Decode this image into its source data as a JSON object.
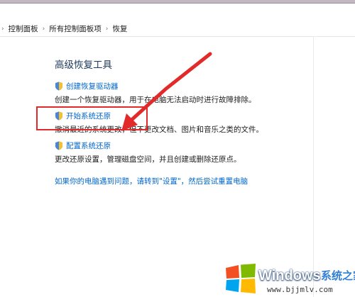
{
  "breadcrumb": {
    "items": [
      "控制面板",
      "所有控制面板项",
      "恢复"
    ],
    "separator": "›"
  },
  "page": {
    "title": "高级恢复工具"
  },
  "tools": [
    {
      "link": "创建恢复驱动器",
      "description": "创建一个恢复驱动器，用于在电脑无法启动时进行故障排除。"
    },
    {
      "link": "开始系统还原",
      "description": "撤消最近的系统更改，但不更改文档、图片和音乐之类的文件。"
    },
    {
      "link": "配置系统还原",
      "description": "更改还原设置，管理磁盘空间，并且创建或删除还原点。"
    }
  ],
  "footer": {
    "link": "如果你的电脑遇到问题，请转到\"设置\"，然后尝试重置电脑"
  },
  "watermark": {
    "brand": "Windows",
    "cn": "系统之家",
    "url": "www.bjjmlv.com"
  },
  "colors": {
    "link": "#0066cc",
    "title": "#1e395b",
    "annotation": "#e32a2a"
  },
  "icons": {
    "uac": "shield-icon"
  }
}
